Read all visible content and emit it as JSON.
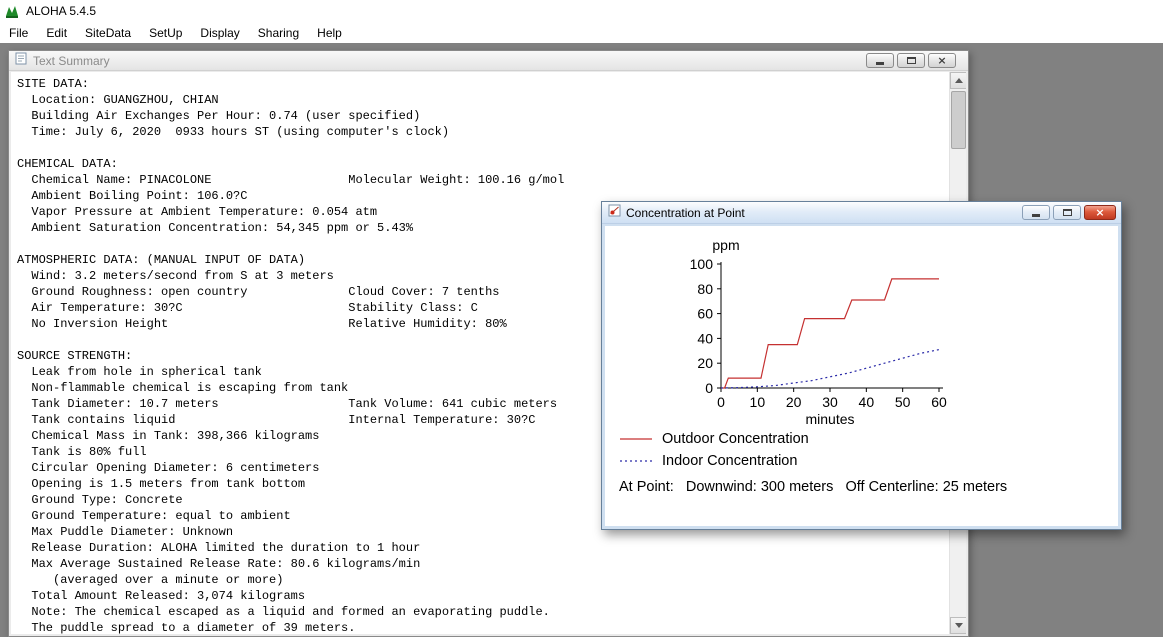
{
  "app": {
    "title": "ALOHA 5.4.5",
    "menu": [
      "File",
      "Edit",
      "SiteData",
      "SetUp",
      "Display",
      "Sharing",
      "Help"
    ]
  },
  "icons": {
    "close": "×",
    "minimize": "horizontal-bar",
    "maximize": "box",
    "scroll_up": "triangle-up",
    "scroll_down": "triangle-down"
  },
  "text_summary_window": {
    "title": "Text Summary",
    "content": "SITE DATA:\n  Location: GUANGZHOU, CHIAN\n  Building Air Exchanges Per Hour: 0.74 (user specified)\n  Time: July 6, 2020  0933 hours ST (using computer's clock)\n\nCHEMICAL DATA:\n  Chemical Name: PINACOLONE                   Molecular Weight: 100.16 g/mol\n  Ambient Boiling Point: 106.0?C\n  Vapor Pressure at Ambient Temperature: 0.054 atm\n  Ambient Saturation Concentration: 54,345 ppm or 5.43%\n\nATMOSPHERIC DATA: (MANUAL INPUT OF DATA)\n  Wind: 3.2 meters/second from S at 3 meters\n  Ground Roughness: open country              Cloud Cover: 7 tenths\n  Air Temperature: 30?C                       Stability Class: C\n  No Inversion Height                         Relative Humidity: 80%\n\nSOURCE STRENGTH:\n  Leak from hole in spherical tank\n  Non-flammable chemical is escaping from tank\n  Tank Diameter: 10.7 meters                  Tank Volume: 641 cubic meters\n  Tank contains liquid                        Internal Temperature: 30?C\n  Chemical Mass in Tank: 398,366 kilograms\n  Tank is 80% full\n  Circular Opening Diameter: 6 centimeters\n  Opening is 1.5 meters from tank bottom\n  Ground Type: Concrete\n  Ground Temperature: equal to ambient\n  Max Puddle Diameter: Unknown\n  Release Duration: ALOHA limited the duration to 1 hour\n  Max Average Sustained Release Rate: 80.6 kilograms/min\n     (averaged over a minute or more)\n  Total Amount Released: 3,074 kilograms\n  Note: The chemical escaped as a liquid and formed an evaporating puddle.\n  The puddle spread to a diameter of 39 meters."
  },
  "concentration_window": {
    "title": "Concentration at Point",
    "at_point_line": "At Point:   Downwind: 300 meters   Off Centerline: 25 meters"
  },
  "chart_data": {
    "type": "line",
    "title": "",
    "ylabel": "ppm",
    "xlabel": "minutes",
    "xlim": [
      0,
      60
    ],
    "ylim": [
      0,
      100
    ],
    "xticks": [
      0,
      10,
      20,
      30,
      40,
      50,
      60
    ],
    "yticks": [
      0,
      20,
      40,
      60,
      80,
      100
    ],
    "grid": false,
    "legend_position": "bottom-left",
    "series": [
      {
        "name": "Outdoor Concentration",
        "color": "#c53131",
        "style": "solid",
        "points": [
          [
            0,
            0
          ],
          [
            1,
            0
          ],
          [
            2,
            8
          ],
          [
            11,
            8
          ],
          [
            13,
            35
          ],
          [
            21,
            35
          ],
          [
            23,
            56
          ],
          [
            34,
            56
          ],
          [
            36,
            71
          ],
          [
            45,
            71
          ],
          [
            47,
            88
          ],
          [
            60,
            88
          ]
        ]
      },
      {
        "name": "Indoor Concentration",
        "color": "#2a2aa8",
        "style": "dotted",
        "points": [
          [
            0,
            0
          ],
          [
            5,
            0.3
          ],
          [
            10,
            1
          ],
          [
            15,
            2
          ],
          [
            20,
            4
          ],
          [
            25,
            6
          ],
          [
            30,
            9
          ],
          [
            35,
            12
          ],
          [
            40,
            16
          ],
          [
            45,
            20
          ],
          [
            50,
            24
          ],
          [
            55,
            28
          ],
          [
            60,
            31
          ]
        ]
      }
    ]
  }
}
